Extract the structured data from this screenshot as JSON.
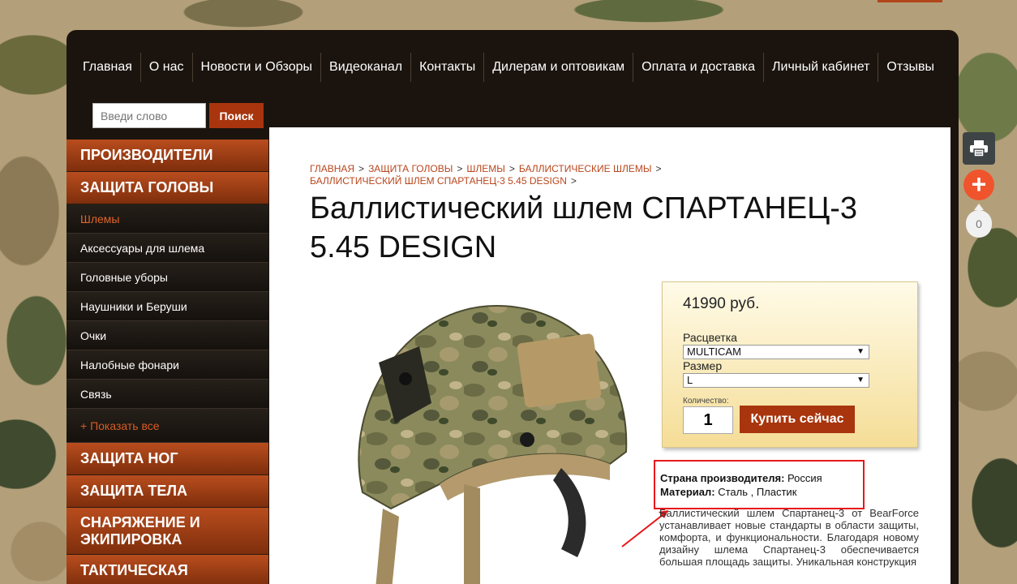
{
  "nav": {
    "items": [
      "Главная",
      "О нас",
      "Новости и Обзоры",
      "Видеоканал",
      "Контакты",
      "Дилерам и оптовикам",
      "Оплата и доставка",
      "Личный кабинет",
      "Отзывы"
    ]
  },
  "search": {
    "placeholder": "Введи слово",
    "button_label": "Поиск"
  },
  "sidebar": {
    "manufacturers": "ПРОИЗВОДИТЕЛИ",
    "head_protection": "ЗАЩИТА ГОЛОВЫ",
    "subitems": [
      "Шлемы",
      "Аксессуары для шлема",
      "Головные уборы",
      "Наушники и Беруши",
      "Очки",
      "Налобные фонари",
      "Связь"
    ],
    "show_all": "+ Показать все",
    "leg_protection": "ЗАЩИТА НОГ",
    "body_protection": "ЗАЩИТА ТЕЛА",
    "equipment_line1": "СНАРЯЖЕНИЕ И",
    "equipment_line2": "ЭКИПИРОВКА",
    "tactical": "ТАКТИЧЕСКАЯ"
  },
  "breadcrumb": [
    "ГЛАВНАЯ",
    "ЗАЩИТА ГОЛОВЫ",
    "ШЛЕМЫ",
    "БАЛЛИСТИЧЕСКИЕ ШЛЕМЫ",
    "БАЛЛИСТИЧЕСКИЙ ШЛЕМ СПАРТАНЕЦ-3 5.45 DESIGN"
  ],
  "breadcrumb_separator": ">",
  "product": {
    "title_line1": "Баллистический шлем СПАРТАНЕЦ-3",
    "title_line2": "5.45 DESIGN",
    "price": "41990 руб.",
    "color_label": "Расцветка",
    "color_value": "MULTICAM",
    "size_label": "Размер",
    "size_value": "L",
    "qty_label": "Количество:",
    "qty_value": "1",
    "buy_label": "Купить сейчас",
    "country_label": "Страна производителя:",
    "country_value": "Россия",
    "material_label": "Материал:",
    "material_value": "Сталь , Пластик",
    "description": "Баллистический шлем Спартанец-3 от BearForce устанавливает новые стандарты в области защиты, комфорта, и функциональности. Благодаря новому дизайну шлема Спартанец-3 обеспечивается большая площадь защиты. Уникальная конструкция"
  },
  "side_tools": {
    "counter": "0",
    "plus": "+"
  },
  "colors": {
    "accent": "#a8350d",
    "dark": "#1b140e",
    "highlight": "#e8171a"
  }
}
